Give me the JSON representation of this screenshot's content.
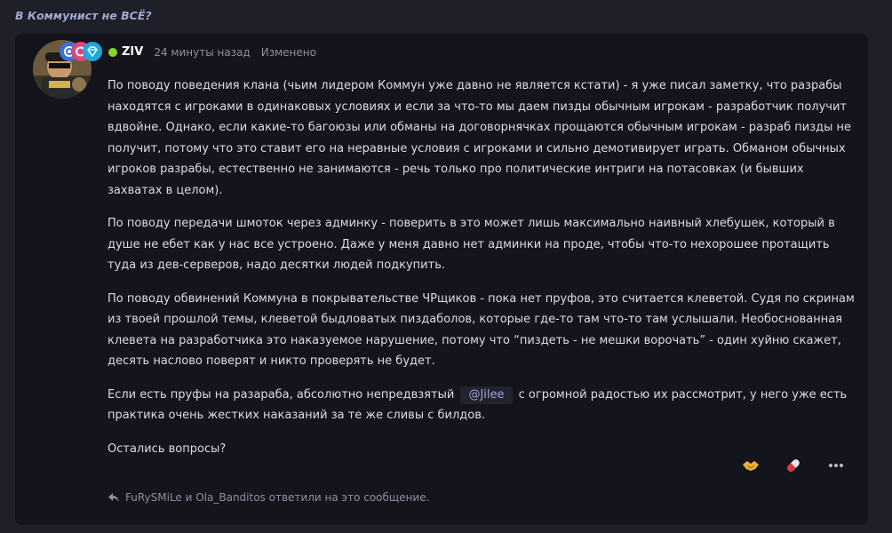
{
  "topic": {
    "title": "В Коммунист не ВСЁ?"
  },
  "post": {
    "author": "ZIV",
    "time": "24 минуты назад",
    "edited": "Изменено",
    "paragraphs": [
      "По поводу поведения клана (чьим лидером Коммун уже давно не является кстати) - я уже писал заметку, что разрабы находятся с игроками в одинаковых условиях и если за что-то мы даем пизды обычным игрокам - разработчик получит вдвойне. Однако, если какие-то багоюзы или обманы на договорнячках прощаются обычным игрокам - разраб пизды не получит, потому что это ставит его на неравные условия с игроками и сильно демотивирует играть. Обманом обычных игроков разрабы, естественно не занимаются - речь только про политические интриги на потасовках (и бывших захватах в целом).",
      "По поводу передачи шмоток через админку - поверить в это может лишь максимально наивный хлебушек, который в душе не ебет как у нас все устроено. Даже у меня давно нет админки на проде, чтобы что-то нехорошее протащить туда из дев-серверов, надо десятки людей подкупить.",
      "По поводу обвинений Коммуна в покрывательстве ЧРщиков - пока нет пруфов, это считается клеветой. Судя по скринам из твоей прошлой темы, клеветой быдловатых пиздаболов, которые где-то там что-то там услышали. Необоснованная клевета на разработчика это наказуемое нарушение, потому что “пиздеть - не мешки ворочать” - один хуйню скажет, десять наслово поверят и никто проверять не будет."
    ],
    "p4_before": "Если есть пруфы на разараба, абсолютно непредвзятый",
    "mention": "@Jilee",
    "p4_after": "с огромной радостью их рассмотрит, у него уже есть практика очень жестких наказаний за те же сливы с билдов.",
    "closing": "Остались вопросы?",
    "replied_text": "FuRySMiLe и Ola_Banditos ответили на это сообщение."
  },
  "icons": {
    "reactions": [
      "handshake-icon",
      "pill-icon",
      "more-icon"
    ],
    "badges": [
      "gear-badge-icon",
      "c-badge-icon",
      "diamond-badge-icon"
    ]
  },
  "colors": {
    "accent": "#a3a9cf",
    "online": "#84d62c",
    "background": "#1f1f2a",
    "post_bg": "#14141c"
  }
}
